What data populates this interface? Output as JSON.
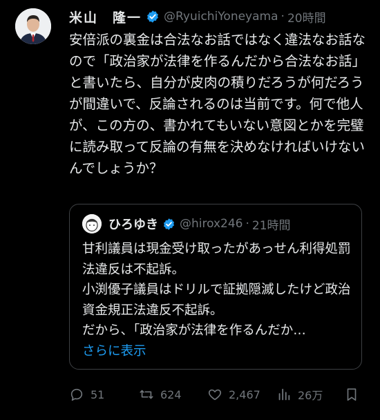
{
  "tweet": {
    "author_name": "米山　隆一",
    "handle": "@RyuichiYoneyama",
    "separator": "·",
    "time": "20時間",
    "text": "安倍派の裏金は合法なお話ではなく違法なお話なので「政治家が法律を作るんだから合法なお話」と書いたら、自分が皮肉の積りだろうが何だろうが間違いで、反論されるのは当前です。何で他人が、この方の、書かれてもいない意図とかを完璧に読み取って反論の有無を決めなければいけないんでしょうか？"
  },
  "quote": {
    "author_name": "ひろゆき",
    "handle": "@hirox246",
    "separator": "·",
    "time": "21時間",
    "lines": [
      "甘利議員は現金受け取ったがあっせん利得処罰法違反は不起訴。",
      "小渕優子議員はドリルで証拠隠滅したけど政治資金規正法違反不起訴。",
      "だから、「政治家が法律を作るんだか…"
    ],
    "show_more": "さらに表示"
  },
  "actions": {
    "replies": "51",
    "retweets": "624",
    "likes": "2,467",
    "views": "26万"
  },
  "colors": {
    "background": "#000000",
    "text": "#e7e9ea",
    "muted": "#71767b",
    "accent": "#1d9bf0",
    "border": "#3e4144"
  },
  "icons": {
    "verified": "verified-badge-icon",
    "reply": "reply-icon",
    "retweet": "retweet-icon",
    "like": "heart-icon",
    "views": "views-icon",
    "bookmark": "bookmark-icon"
  }
}
